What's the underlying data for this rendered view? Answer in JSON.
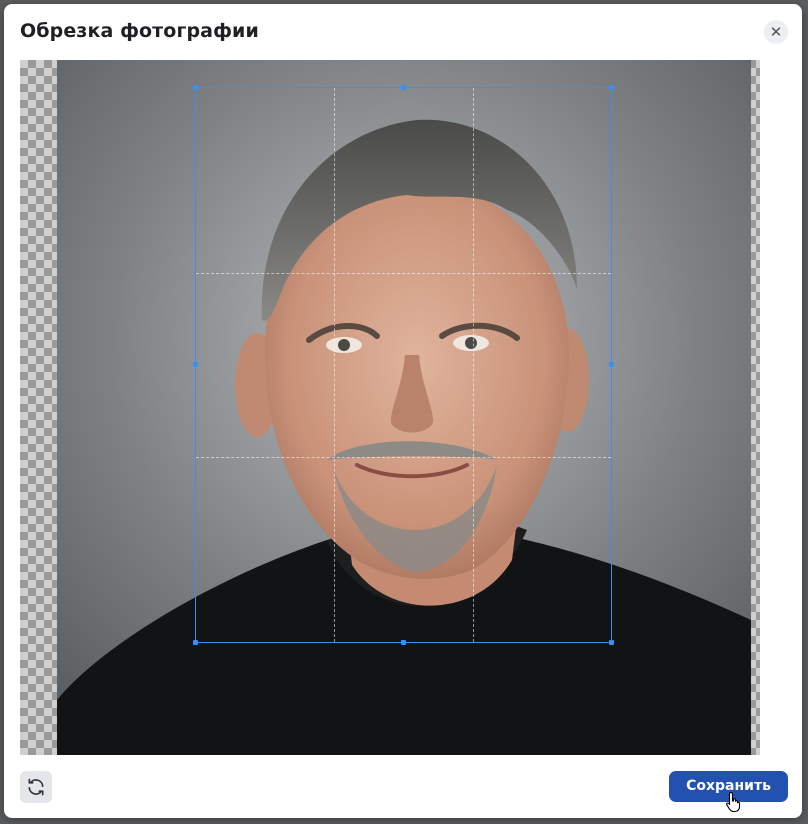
{
  "dialog": {
    "title": "Обрезка фотографии",
    "close_icon": "close-icon",
    "close_glyph": "✕"
  },
  "editor": {
    "crop_overlay": "crop-selection",
    "background": "transparent-checkerboard"
  },
  "footer": {
    "rotate_icon": "rotate-icon",
    "save_label": "Сохранить"
  },
  "colors": {
    "accent": "#3b8ff0",
    "primary_button": "#2251b0"
  }
}
